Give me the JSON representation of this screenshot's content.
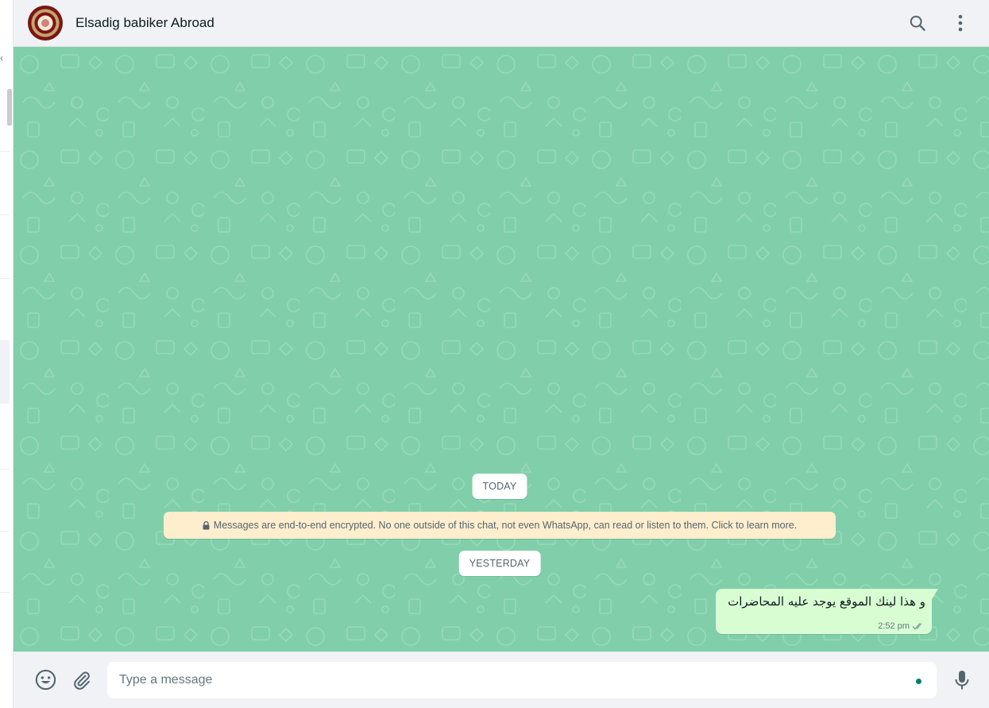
{
  "header": {
    "contact_name": "Elsadig babiker Abroad",
    "icons": [
      "search-icon",
      "menu-dots-icon"
    ]
  },
  "chat": {
    "date_today": "TODAY",
    "encryption_notice": "Messages are end-to-end encrypted. No one outside of this chat, not even WhatsApp, can read or listen to them. Click to learn more.",
    "date_yesterday": "YESTERDAY",
    "messages": [
      {
        "text": "و هذا لينك الموقع يوجد عليه المحاضرات",
        "time": "2:52 pm",
        "status": "read-double-check",
        "direction": "outgoing"
      }
    ]
  },
  "composer": {
    "placeholder": "Type a message",
    "icons": [
      "emoji-icon",
      "attach-icon",
      "mic-icon"
    ]
  },
  "colors": {
    "chat_background": "#80cfaa",
    "outgoing_bubble": "#d9fdd3",
    "banner": "#ffeecd",
    "accent": "#008069"
  }
}
